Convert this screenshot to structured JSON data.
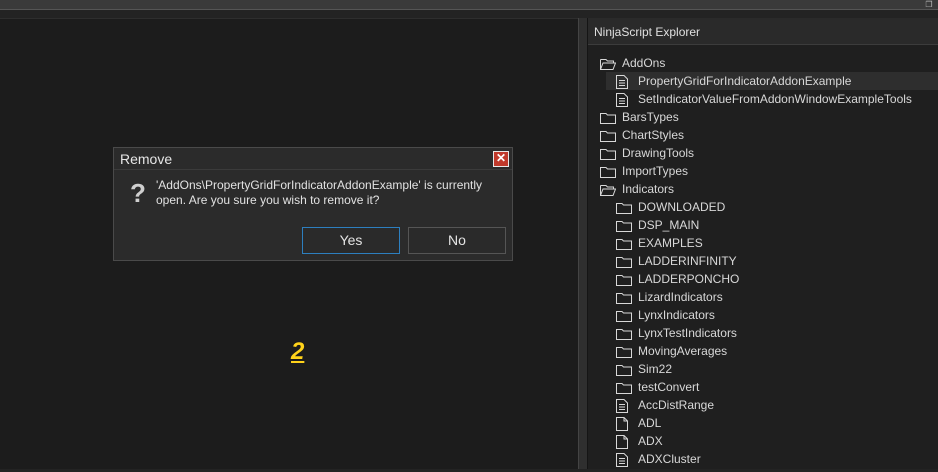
{
  "topbar": {
    "corner_icon": "restore-icon"
  },
  "marker": {
    "text": "2"
  },
  "dialog": {
    "title": "Remove",
    "message_line1": "'AddOns\\PropertyGridForIndicatorAddonExample' is currently",
    "message_line2": "open. Are you sure you wish to remove it?",
    "yes_label": "Yes",
    "no_label": "No",
    "question_glyph": "?",
    "close_glyph": "✕"
  },
  "explorer": {
    "title": "NinjaScript Explorer",
    "items": [
      {
        "label": "AddOns",
        "kind": "folder-open",
        "level": 0
      },
      {
        "label": "PropertyGridForIndicatorAddonExample",
        "kind": "file",
        "level": 1,
        "selected": true
      },
      {
        "label": "SetIndicatorValueFromAddonWindowExampleTools",
        "kind": "file",
        "level": 1
      },
      {
        "label": "BarsTypes",
        "kind": "folder",
        "level": 0
      },
      {
        "label": "ChartStyles",
        "kind": "folder",
        "level": 0
      },
      {
        "label": "DrawingTools",
        "kind": "folder",
        "level": 0
      },
      {
        "label": "ImportTypes",
        "kind": "folder",
        "level": 0
      },
      {
        "label": "Indicators",
        "kind": "folder-open",
        "level": 0
      },
      {
        "label": "DOWNLOADED",
        "kind": "folder",
        "level": 1
      },
      {
        "label": "DSP_MAIN",
        "kind": "folder",
        "level": 1
      },
      {
        "label": "EXAMPLES",
        "kind": "folder",
        "level": 1
      },
      {
        "label": "LADDERINFINITY",
        "kind": "folder",
        "level": 1
      },
      {
        "label": "LADDERPONCHO",
        "kind": "folder",
        "level": 1
      },
      {
        "label": "LizardIndicators",
        "kind": "folder",
        "level": 1
      },
      {
        "label": "LynxIndicators",
        "kind": "folder",
        "level": 1
      },
      {
        "label": "LynxTestIndicators",
        "kind": "folder",
        "level": 1
      },
      {
        "label": "MovingAverages",
        "kind": "folder",
        "level": 1
      },
      {
        "label": "Sim22",
        "kind": "folder",
        "level": 1
      },
      {
        "label": "testConvert",
        "kind": "folder",
        "level": 1
      },
      {
        "label": "AccDistRange",
        "kind": "file",
        "level": 1
      },
      {
        "label": "ADL",
        "kind": "file-blank",
        "level": 1
      },
      {
        "label": "ADX",
        "kind": "file-blank",
        "level": 1
      },
      {
        "label": "ADXCluster",
        "kind": "file",
        "level": 1
      }
    ]
  }
}
